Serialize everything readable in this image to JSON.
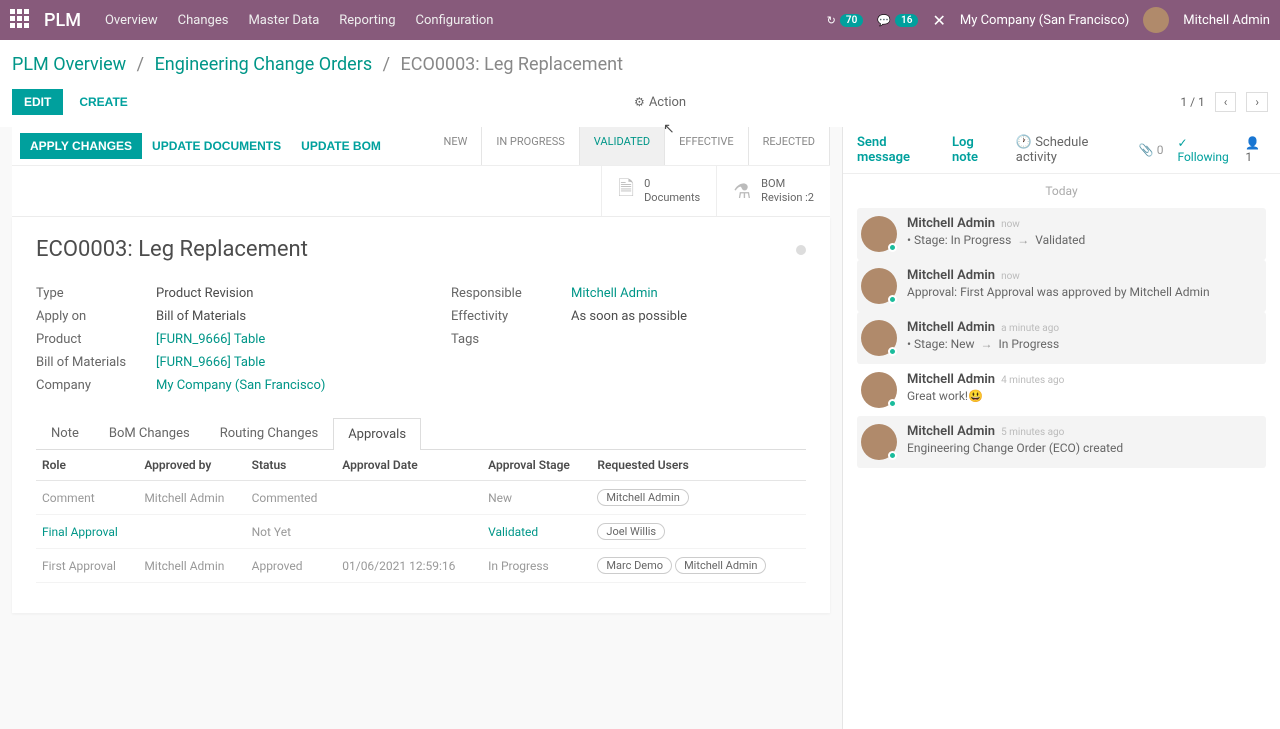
{
  "topbar": {
    "app": "PLM",
    "menu": [
      "Overview",
      "Changes",
      "Master Data",
      "Reporting",
      "Configuration"
    ],
    "activity_count": "70",
    "msg_count": "16",
    "company": "My Company (San Francisco)",
    "user": "Mitchell Admin"
  },
  "breadcrumb": {
    "a": "PLM Overview",
    "b": "Engineering Change Orders",
    "c": "ECO0003: Leg Replacement"
  },
  "controls": {
    "edit": "EDIT",
    "create": "CREATE",
    "action": "Action",
    "page": "1 / 1"
  },
  "status": {
    "apply": "APPLY CHANGES",
    "update_doc": "UPDATE DOCUMENTS",
    "update_bom": "UPDATE BOM",
    "stages": [
      "NEW",
      "IN PROGRESS",
      "VALIDATED",
      "EFFECTIVE",
      "REJECTED"
    ],
    "active_stage": 2
  },
  "stats": {
    "docs_n": "0",
    "docs_l": "Documents",
    "bom_l1": "BOM",
    "bom_l2": "Revision :2"
  },
  "record": {
    "title": "ECO0003: Leg Replacement",
    "labels": {
      "type": "Type",
      "apply_on": "Apply on",
      "product": "Product",
      "bom": "Bill of Materials",
      "company": "Company",
      "responsible": "Responsible",
      "effectivity": "Effectivity",
      "tags": "Tags"
    },
    "type": "Product Revision",
    "apply_on": "Bill of Materials",
    "product": "[FURN_9666] Table",
    "bom": "[FURN_9666] Table",
    "company": "My Company (San Francisco)",
    "responsible": "Mitchell Admin",
    "effectivity": "As soon as possible"
  },
  "tabs": [
    "Note",
    "BoM Changes",
    "Routing Changes",
    "Approvals"
  ],
  "approvals": {
    "cols": [
      "Role",
      "Approved by",
      "Status",
      "Approval Date",
      "Approval Stage",
      "Requested Users"
    ],
    "rows": [
      {
        "role": "Comment",
        "by": "Mitchell Admin",
        "status": "Commented",
        "date": "",
        "stage": "New",
        "users": [
          "Mitchell Admin"
        ]
      },
      {
        "role": "Final Approval",
        "by": "",
        "status": "Not Yet",
        "date": "",
        "stage": "Validated",
        "users": [
          "Joel Willis"
        ]
      },
      {
        "role": "First Approval",
        "by": "Mitchell Admin",
        "status": "Approved",
        "date": "01/06/2021 12:59:16",
        "stage": "In Progress",
        "users": [
          "Marc Demo",
          "Mitchell Admin"
        ]
      }
    ]
  },
  "chatter": {
    "send": "Send message",
    "log": "Log note",
    "schedule": "Schedule activity",
    "attach": "0",
    "following": "Following",
    "followers": "1",
    "today": "Today",
    "msgs": [
      {
        "author": "Mitchell Admin",
        "time": "now",
        "body": "Stage: In Progress → Validated",
        "bullet": true,
        "hl": true
      },
      {
        "author": "Mitchell Admin",
        "time": "now",
        "body": "Approval: First Approval was approved by Mitchell Admin",
        "hl": true
      },
      {
        "author": "Mitchell Admin",
        "time": "a minute ago",
        "body": "Stage: New → In Progress",
        "bullet": true,
        "hl": true
      },
      {
        "author": "Mitchell Admin",
        "time": "4 minutes ago",
        "body": "Great work!😃"
      },
      {
        "author": "Mitchell Admin",
        "time": "5 minutes ago",
        "body": "Engineering Change Order (ECO) created",
        "hl": true
      }
    ]
  }
}
